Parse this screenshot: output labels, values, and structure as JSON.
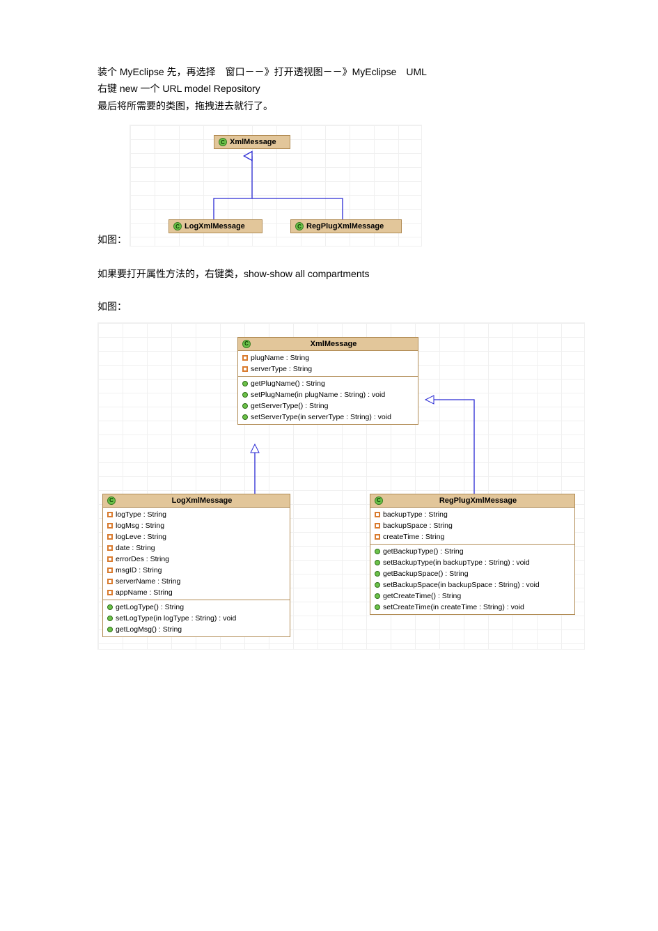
{
  "intro": {
    "line1": "装个 MyEclipse 先，再选择　窗口－－》打开透视图－－》MyEclipse　UML",
    "line2": "右键 new 一个 URL model Repository",
    "line3": "最后将所需要的类图，拖拽进去就行了。"
  },
  "fig1_label": "如图：",
  "mid_text": "如果要打开属性方法的，右键类，show-show all compartments",
  "fig2_label": "如图：",
  "diagram1": {
    "classes": {
      "top": {
        "name": "XmlMessage"
      },
      "left": {
        "name": "LogXmlMessage"
      },
      "right": {
        "name": "RegPlugXmlMessage"
      }
    }
  },
  "diagram2": {
    "parent": {
      "name": "XmlMessage",
      "attrs": [
        "plugName : String",
        "serverType : String"
      ],
      "methods": [
        "getPlugName() : String",
        "setPlugName(in plugName : String) : void",
        "getServerType() : String",
        "setServerType(in serverType : String) : void"
      ]
    },
    "left": {
      "name": "LogXmlMessage",
      "attrs": [
        "logType : String",
        "logMsg : String",
        "logLeve : String",
        "date : String",
        "errorDes : String",
        "msgID : String",
        "serverName : String",
        "appName : String"
      ],
      "methods": [
        "getLogType() : String",
        "setLogType(in logType : String) : void",
        "getLogMsg() : String"
      ]
    },
    "right": {
      "name": "RegPlugXmlMessage",
      "attrs": [
        "backupType : String",
        "backupSpace : String",
        "createTime : String"
      ],
      "methods": [
        "getBackupType() : String",
        "setBackupType(in backupType : String) : void",
        "getBackupSpace() : String",
        "setBackupSpace(in backupSpace : String) : void",
        "getCreateTime() : String",
        "setCreateTime(in createTime : String) : void"
      ]
    }
  }
}
